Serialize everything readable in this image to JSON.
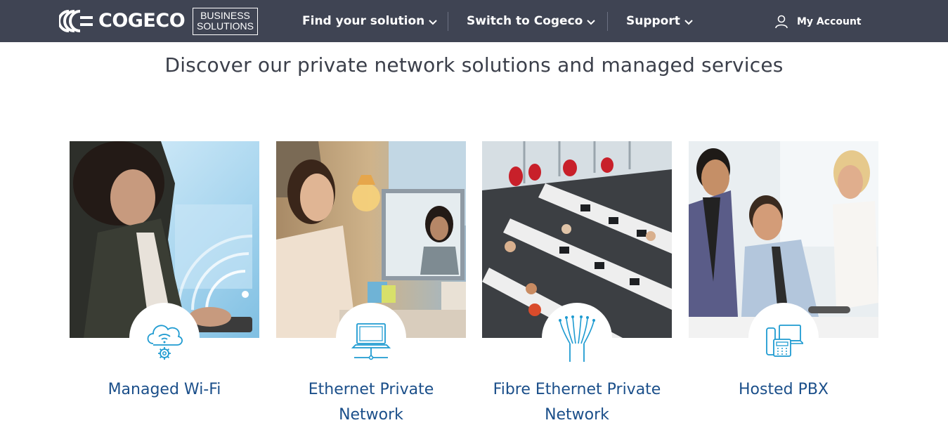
{
  "header": {
    "brand_name": "COGECO",
    "sub_brand": [
      "BUSINESS",
      "SOLUTIONS"
    ],
    "nav": [
      {
        "label": "Find your solution",
        "icon": "chevron-down-icon"
      },
      {
        "label": "Switch to Cogeco",
        "icon": "chevron-down-icon"
      },
      {
        "label": "Support",
        "icon": "chevron-down-icon"
      }
    ],
    "account_label": "My Account",
    "account_icon": "user-icon"
  },
  "main": {
    "title": "Discover our private network solutions and managed services",
    "cards": [
      {
        "label": "Managed Wi-Fi",
        "icon": "cloud-wifi-gear-icon",
        "photo": "woman-using-tablet-photo"
      },
      {
        "label": "Ethernet Private Network",
        "icon": "laptop-network-icon",
        "photo": "video-conference-photo"
      },
      {
        "label": "Fibre Ethernet Private Network",
        "icon": "fibre-optic-icon",
        "photo": "open-office-photo"
      },
      {
        "label": "Hosted PBX",
        "icon": "phone-system-icon",
        "photo": "business-team-photo"
      }
    ]
  },
  "colors": {
    "header_bg": "#3f4453",
    "title_text": "#3b3f4a",
    "card_label": "#1b4f8a",
    "icon_accent": "#1f9bd1"
  }
}
